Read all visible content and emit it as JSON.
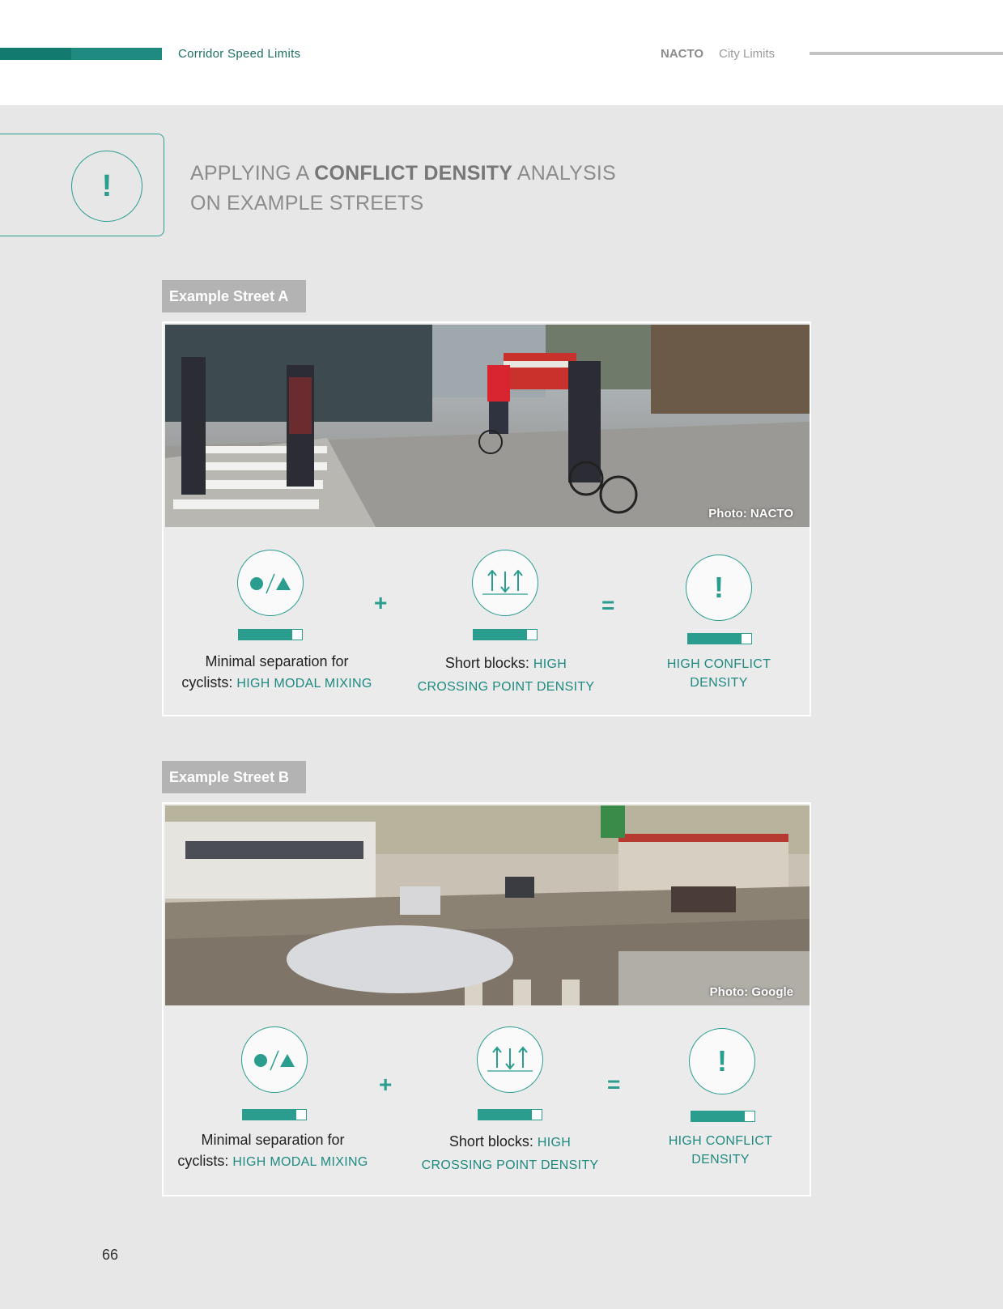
{
  "header": {
    "section_title": "Corridor Speed Limits",
    "brand": "NACTO",
    "book_title": "City Limits"
  },
  "callout": {
    "icon": "exclamation-icon",
    "symbol": "!",
    "heading_pre": "APPLYING A ",
    "heading_bold": "CONFLICT DENSITY",
    "heading_post": " ANALYSIS",
    "heading_line2": "ON EXAMPLE STREETS"
  },
  "streets": [
    {
      "label": "Example Street A",
      "photo_credit": "Photo:  NACTO",
      "factor1": {
        "icon": "modal-mixing-icon",
        "level": 0.85,
        "text": "Minimal separation for",
        "text2": "cyclists: ",
        "highlight": "HIGH MODAL MIXING"
      },
      "plus": "+",
      "factor2": {
        "icon": "crossing-arrows-icon",
        "level": 0.85,
        "text": "Short blocks: ",
        "highlight": "HIGH",
        "highlight2": "CROSSING POINT DENSITY"
      },
      "equals": "=",
      "result": {
        "icon": "exclamation-icon",
        "symbol": "!",
        "level": 0.85,
        "line1": "HIGH CONFLICT",
        "line2": "DENSITY"
      }
    },
    {
      "label": "Example Street B",
      "photo_credit": "Photo:  Google",
      "factor1": {
        "icon": "modal-mixing-icon",
        "level": 0.85,
        "text": "Minimal separation for",
        "text2": "cyclists: ",
        "highlight": "HIGH MODAL MIXING"
      },
      "plus": "+",
      "factor2": {
        "icon": "crossing-arrows-icon",
        "level": 0.85,
        "text": "Short blocks: ",
        "highlight": "HIGH",
        "highlight2": "CROSSING POINT DENSITY"
      },
      "equals": "=",
      "result": {
        "icon": "exclamation-icon",
        "symbol": "!",
        "level": 0.85,
        "line1": "HIGH CONFLICT",
        "line2": "DENSITY"
      }
    }
  ],
  "page_number": "66",
  "colors": {
    "teal": "#2a9d8f",
    "dark_teal": "#1e8a80",
    "label_grey": "#b3b3b3",
    "background": "#e7e7e7"
  }
}
